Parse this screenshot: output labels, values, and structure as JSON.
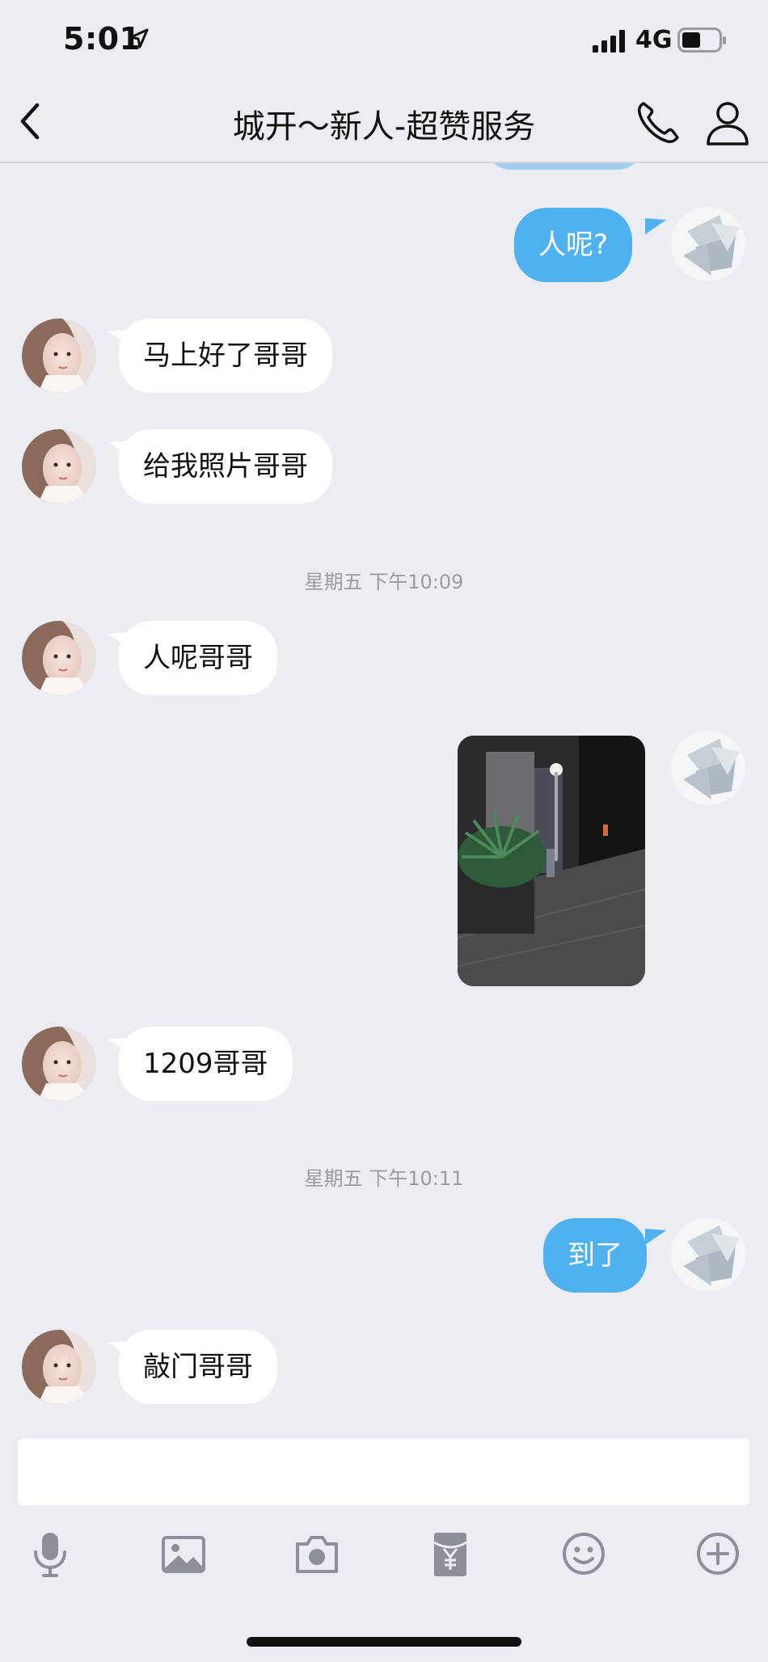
{
  "status_bar": {
    "time": "5:01",
    "network": "4G"
  },
  "header": {
    "title": "城开～新人-超赞服务"
  },
  "messages": [
    {
      "side": "out",
      "text": "人呢?"
    },
    {
      "side": "in",
      "text": "马上好了哥哥"
    },
    {
      "side": "in",
      "text": "给我照片哥哥"
    },
    {
      "timestamp": "星期五 下午10:09"
    },
    {
      "side": "in",
      "text": "人呢哥哥"
    },
    {
      "side": "out",
      "type": "image"
    },
    {
      "side": "in",
      "text": "1209哥哥"
    },
    {
      "timestamp": "星期五 下午10:11"
    },
    {
      "side": "out",
      "text": "到了"
    },
    {
      "side": "in",
      "text": "敲门哥哥"
    }
  ],
  "input": {
    "value": "",
    "placeholder": ""
  },
  "toolbar": [
    "microphone-icon",
    "image-icon",
    "camera-icon",
    "red-packet-icon",
    "emoji-icon",
    "plus-icon"
  ],
  "colors": {
    "background": "#ecedf2",
    "outgoing_bubble": "#4fb1ef",
    "incoming_bubble": "#ffffff",
    "timestamp": "#9a9ba0"
  }
}
